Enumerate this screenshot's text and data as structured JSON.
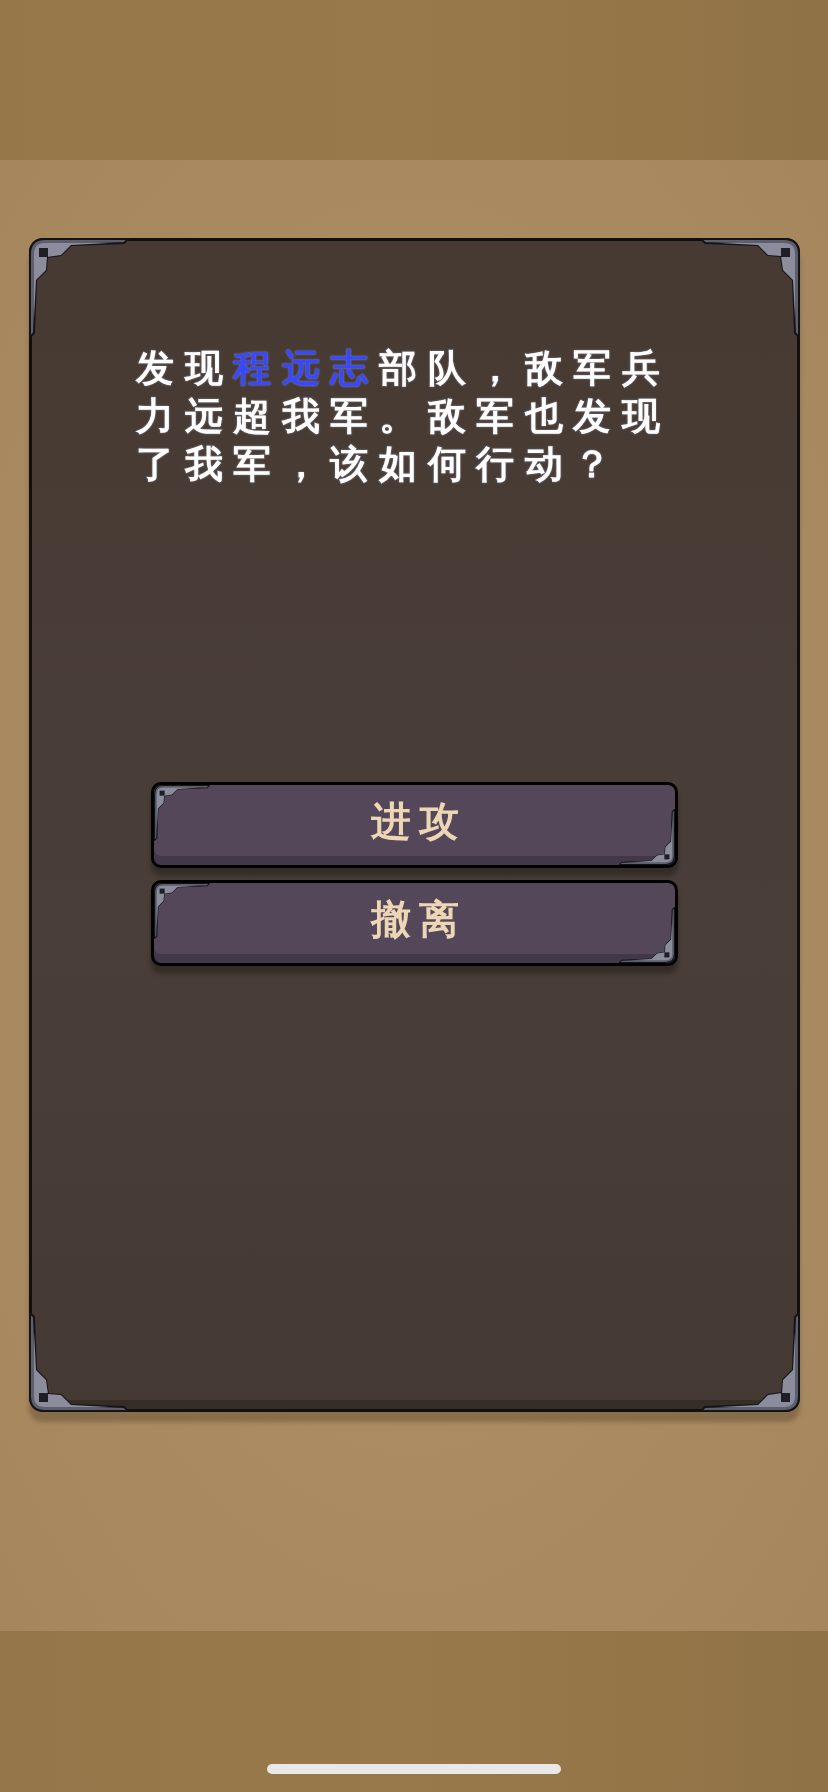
{
  "dialog": {
    "message": [
      {
        "text": "发现",
        "color": "#ffffff"
      },
      {
        "text": "程远志",
        "color": "#3848ff"
      },
      {
        "text": "部队，敌军兵力远超我军。敌军也发现了我军，该如何行动？",
        "color": "#ffffff"
      }
    ],
    "choices": [
      "进攻",
      "撤离"
    ]
  }
}
